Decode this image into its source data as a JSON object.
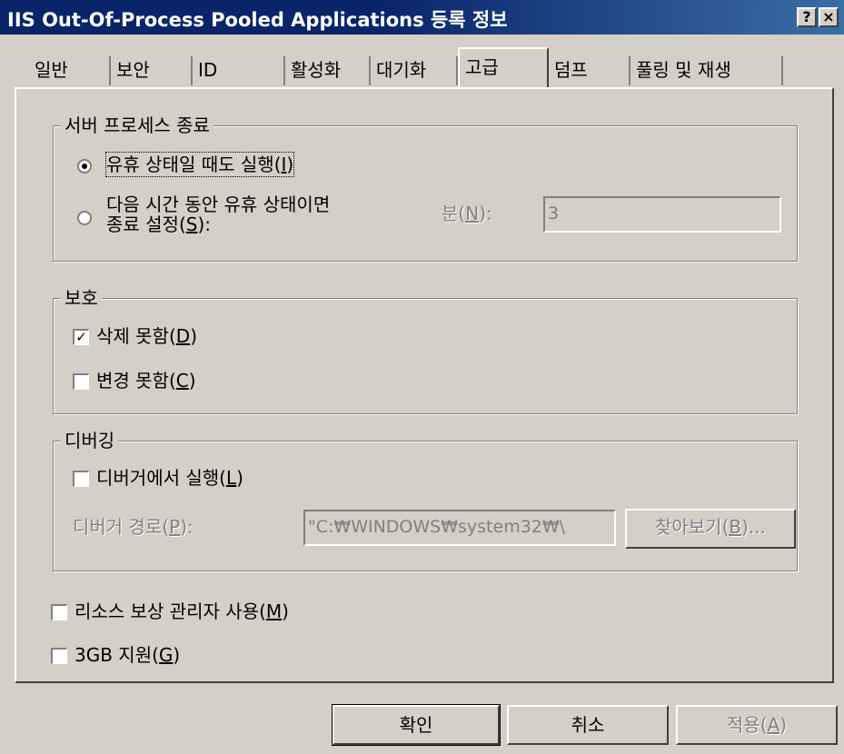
{
  "window": {
    "title": "IIS Out-Of-Process Pooled Applications 등록 정보",
    "help_glyph": "?",
    "close_glyph": "×"
  },
  "tabs": [
    {
      "label": "일반"
    },
    {
      "label": "보안"
    },
    {
      "label": "ID"
    },
    {
      "label": "활성화"
    },
    {
      "label": "대기화"
    },
    {
      "label": "고급"
    },
    {
      "label": "덤프"
    },
    {
      "label": "풀링 및 재생"
    }
  ],
  "active_tab": "고급",
  "server_shutdown": {
    "legend": "서버 프로세스 종료",
    "radio_idle_run": "유휴 상태일 때도 실행",
    "radio_idle_run_key": "I",
    "radio_shutdown_line1": "다음 시간 동안 유휴 상태이면",
    "radio_shutdown_line2": "종료 설정",
    "radio_shutdown_key": "S",
    "minutes_label": "분",
    "minutes_key": "N",
    "minutes_value": "3"
  },
  "protection": {
    "legend": "보호",
    "no_delete": "삭제 못함",
    "no_delete_key": "D",
    "no_change": "변경 못함",
    "no_change_key": "C",
    "check_mark": "✓"
  },
  "debugging": {
    "legend": "디버깅",
    "run_in_debugger": "디버거에서 실행",
    "run_in_debugger_key": "L",
    "debugger_path_label": "디버거 경로",
    "debugger_path_key": "P",
    "debugger_path_value": "\"C:₩WINDOWS₩system32₩\\",
    "browse_label": "찾아보기",
    "browse_key": "B",
    "browse_suffix": "..."
  },
  "options": {
    "resource_dispenser": "리소스 보상 관리자 사용",
    "resource_dispenser_key": "M",
    "support_3gb": "3GB 지원",
    "support_3gb_key": "G"
  },
  "footer": {
    "ok_label": "확인",
    "cancel_label": "취소",
    "apply_label": "적용",
    "apply_key": "A"
  }
}
